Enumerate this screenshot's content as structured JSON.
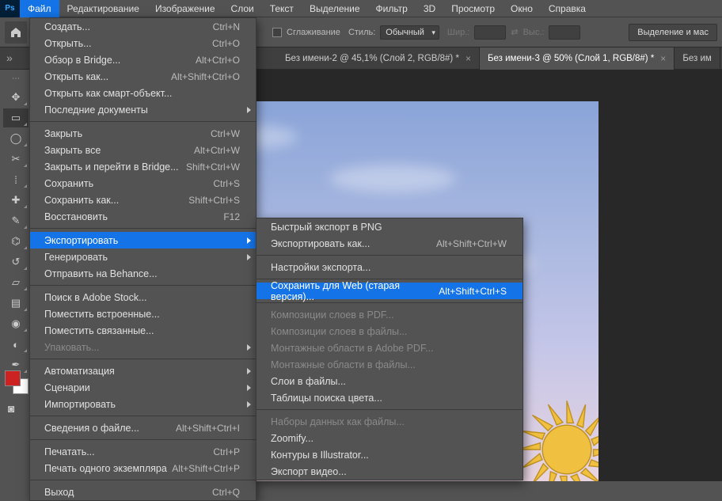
{
  "menubar": {
    "logo": "Ps",
    "items": [
      "Файл",
      "Редактирование",
      "Изображение",
      "Слои",
      "Текст",
      "Выделение",
      "Фильтр",
      "3D",
      "Просмотр",
      "Окно",
      "Справка"
    ]
  },
  "options": {
    "antialias": "Сглаживание",
    "style_label": "Стиль:",
    "style_value": "Обычный",
    "width_label": "Шир.:",
    "height_label": "Выс.:",
    "right_button": "Выделение и мас"
  },
  "tabs": [
    {
      "label": "Без имени-2 @ 45,1% (Слой 2, RGB/8#) *",
      "active": false
    },
    {
      "label": "Без имени-3 @ 50% (Слой 1, RGB/8#) *",
      "active": true
    },
    {
      "label": "Без им",
      "active": false
    }
  ],
  "file_menu": [
    {
      "type": "item",
      "label": "Создать...",
      "shortcut": "Ctrl+N"
    },
    {
      "type": "item",
      "label": "Открыть...",
      "shortcut": "Ctrl+O"
    },
    {
      "type": "item",
      "label": "Обзор в Bridge...",
      "shortcut": "Alt+Ctrl+O"
    },
    {
      "type": "item",
      "label": "Открыть как...",
      "shortcut": "Alt+Shift+Ctrl+O"
    },
    {
      "type": "item",
      "label": "Открыть как смарт-объект..."
    },
    {
      "type": "submenu",
      "label": "Последние документы"
    },
    {
      "type": "sep"
    },
    {
      "type": "item",
      "label": "Закрыть",
      "shortcut": "Ctrl+W"
    },
    {
      "type": "item",
      "label": "Закрыть все",
      "shortcut": "Alt+Ctrl+W"
    },
    {
      "type": "item",
      "label": "Закрыть и перейти в Bridge...",
      "shortcut": "Shift+Ctrl+W"
    },
    {
      "type": "item",
      "label": "Сохранить",
      "shortcut": "Ctrl+S"
    },
    {
      "type": "item",
      "label": "Сохранить как...",
      "shortcut": "Shift+Ctrl+S"
    },
    {
      "type": "item",
      "label": "Восстановить",
      "shortcut": "F12"
    },
    {
      "type": "sep"
    },
    {
      "type": "submenu",
      "label": "Экспортировать",
      "highlight": true
    },
    {
      "type": "submenu",
      "label": "Генерировать"
    },
    {
      "type": "item",
      "label": "Отправить на Behance..."
    },
    {
      "type": "sep"
    },
    {
      "type": "item",
      "label": "Поиск в Adobe Stock..."
    },
    {
      "type": "item",
      "label": "Поместить встроенные..."
    },
    {
      "type": "item",
      "label": "Поместить связанные..."
    },
    {
      "type": "submenu",
      "label": "Упаковать...",
      "disabled": true
    },
    {
      "type": "sep"
    },
    {
      "type": "submenu",
      "label": "Автоматизация"
    },
    {
      "type": "submenu",
      "label": "Сценарии"
    },
    {
      "type": "submenu",
      "label": "Импортировать"
    },
    {
      "type": "sep"
    },
    {
      "type": "item",
      "label": "Сведения о файле...",
      "shortcut": "Alt+Shift+Ctrl+I"
    },
    {
      "type": "sep"
    },
    {
      "type": "item",
      "label": "Печатать...",
      "shortcut": "Ctrl+P"
    },
    {
      "type": "item",
      "label": "Печать одного экземпляра",
      "shortcut": "Alt+Shift+Ctrl+P"
    },
    {
      "type": "sep"
    },
    {
      "type": "item",
      "label": "Выход",
      "shortcut": "Ctrl+Q"
    }
  ],
  "export_menu": [
    {
      "type": "item",
      "label": "Быстрый экспорт в PNG"
    },
    {
      "type": "item",
      "label": "Экспортировать как...",
      "shortcut": "Alt+Shift+Ctrl+W"
    },
    {
      "type": "sep"
    },
    {
      "type": "item",
      "label": "Настройки экспорта..."
    },
    {
      "type": "sep"
    },
    {
      "type": "item",
      "label": "Сохранить для Web (старая версия)...",
      "shortcut": "Alt+Shift+Ctrl+S",
      "highlight": true
    },
    {
      "type": "sep"
    },
    {
      "type": "item",
      "label": "Композиции слоев в PDF...",
      "disabled": true
    },
    {
      "type": "item",
      "label": "Композиции слоев в файлы...",
      "disabled": true
    },
    {
      "type": "item",
      "label": "Монтажные области в Adobe PDF...",
      "disabled": true
    },
    {
      "type": "item",
      "label": "Монтажные области в файлы...",
      "disabled": true
    },
    {
      "type": "item",
      "label": "Слои в файлы..."
    },
    {
      "type": "item",
      "label": "Таблицы поиска цвета..."
    },
    {
      "type": "sep"
    },
    {
      "type": "item",
      "label": "Наборы данных как файлы...",
      "disabled": true
    },
    {
      "type": "item",
      "label": "Zoomify..."
    },
    {
      "type": "item",
      "label": "Контуры в Illustrator..."
    },
    {
      "type": "item",
      "label": "Экспорт видео..."
    }
  ],
  "tools": [
    "move",
    "marquee",
    "lasso",
    "crop",
    "eyedropper",
    "heal",
    "brush",
    "stamp",
    "history",
    "eraser",
    "gradient",
    "blur",
    "dodge",
    "pen",
    "type",
    "path",
    "rect",
    "hand",
    "zoom"
  ]
}
